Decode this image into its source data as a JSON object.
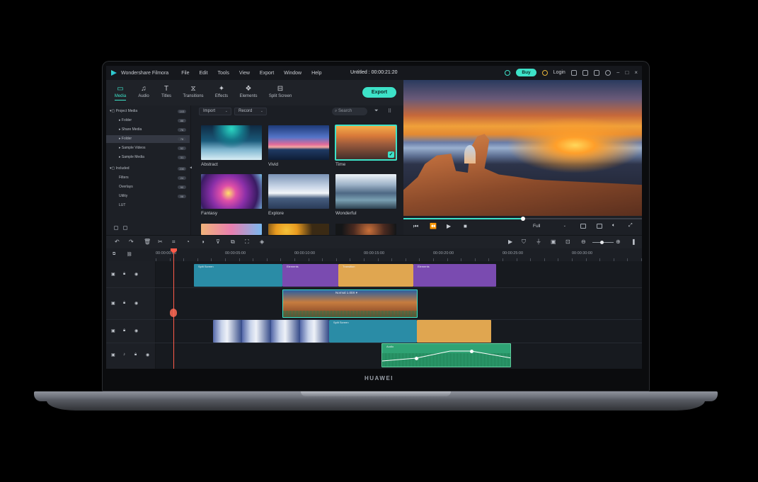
{
  "device": {
    "brand": "HUAWEI"
  },
  "titlebar": {
    "app_name": "Wondershare Filmora",
    "menu": [
      "File",
      "Edit",
      "Tools",
      "View",
      "Export",
      "Window",
      "Help"
    ],
    "doc_title": "Untitled : 00:00:21:20",
    "buy_label": "Buy",
    "login_label": "Login",
    "accent": "#3de2c8"
  },
  "media_tabs": [
    {
      "label": "Media",
      "icon": "folder-icon",
      "active": true
    },
    {
      "label": "Audio",
      "icon": "music-note-icon",
      "active": false
    },
    {
      "label": "Titles",
      "icon": "text-t-icon",
      "active": false
    },
    {
      "label": "Transitions",
      "icon": "transition-icon",
      "active": false
    },
    {
      "label": "Effects",
      "icon": "effects-icon",
      "active": false
    },
    {
      "label": "Elements",
      "icon": "elements-icon",
      "active": false
    },
    {
      "label": "Split Screen",
      "icon": "split-screen-icon",
      "active": false
    }
  ],
  "export_label": "Export",
  "tree": {
    "items": [
      {
        "label": "Project Media",
        "count": "103"
      },
      {
        "label": "Folder",
        "count": "88"
      },
      {
        "label": "Share Media",
        "count": "76"
      },
      {
        "label": "Folder",
        "count": "78"
      },
      {
        "label": "Sample Videos",
        "count": "52"
      },
      {
        "label": "Sample Media",
        "count": "31"
      },
      {
        "label": "Included",
        "count": "230"
      },
      {
        "label": "Filters",
        "count": "24"
      },
      {
        "label": "Overlays",
        "count": "90"
      },
      {
        "label": "Utility",
        "count": "08"
      },
      {
        "label": "LUT",
        "count": ""
      }
    ]
  },
  "browser": {
    "import_label": "Import",
    "record_label": "Record",
    "search_placeholder": "Search",
    "thumbs": [
      {
        "label": "Abstract"
      },
      {
        "label": "Vivid"
      },
      {
        "label": "Time"
      },
      {
        "label": "Fantasy"
      },
      {
        "label": "Explore"
      },
      {
        "label": "Wonderful"
      }
    ],
    "selected_check": "✓"
  },
  "preview": {
    "zoom_label": "Full",
    "progress": 0.5
  },
  "timeline": {
    "ruler": [
      "00:00:00:00",
      "00:00:05:00",
      "00:00:10:00",
      "00:00:15:00",
      "00:00:20:00",
      "00:00:25:00",
      "00:00:30:00"
    ],
    "speed_tag": "Normal 1.00X ▾",
    "clips": {
      "t1a": "Split Screen",
      "t1b": "Elements",
      "t1c": "Transition",
      "t1d": "Elements",
      "t3b": "Split Screen",
      "t4": "Audio"
    }
  }
}
